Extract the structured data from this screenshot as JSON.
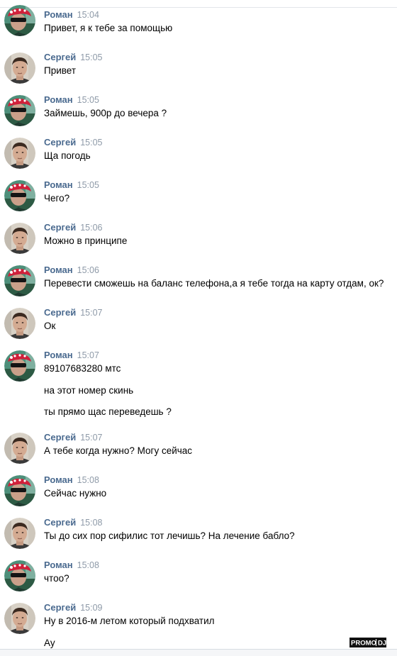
{
  "logo_text": "PROMO DJ",
  "messages": [
    {
      "author": "Роман",
      "time": "15:04",
      "lines": [
        "Привет, я к тебе за помощью"
      ]
    },
    {
      "author": "Сергей",
      "time": "15:05",
      "lines": [
        "Привет"
      ]
    },
    {
      "author": "Роман",
      "time": "15:05",
      "lines": [
        "Займешь, 900р до вечера ?"
      ]
    },
    {
      "author": "Сергей",
      "time": "15:05",
      "lines": [
        "Ща погодь"
      ]
    },
    {
      "author": "Роман",
      "time": "15:05",
      "lines": [
        "Чего?"
      ]
    },
    {
      "author": "Сергей",
      "time": "15:06",
      "lines": [
        "Можно в принципе"
      ]
    },
    {
      "author": "Роман",
      "time": "15:06",
      "lines": [
        "Перевести сможешь на баланс телефона,а я тебе тогда на карту отдам, ок?"
      ]
    },
    {
      "author": "Сергей",
      "time": "15:07",
      "lines": [
        "Ок"
      ]
    },
    {
      "author": "Роман",
      "time": "15:07",
      "lines": [
        "89107683280 мтс",
        "на этот номер скинь",
        "ты прямо щас переведешь ?"
      ]
    },
    {
      "author": "Сергей",
      "time": "15:07",
      "lines": [
        "А тебе когда нужно? Могу сейчас"
      ]
    },
    {
      "author": "Роман",
      "time": "15:08",
      "lines": [
        "Сейчас нужно"
      ]
    },
    {
      "author": "Сергей",
      "time": "15:08",
      "lines": [
        "Ты до сих пор сифилис тот лечишь? На лечение бабло?"
      ]
    },
    {
      "author": "Роман",
      "time": "15:08",
      "lines": [
        "чтоо?"
      ]
    },
    {
      "author": "Сергей",
      "time": "15:09",
      "lines": [
        "Ну в 2016-м летом который подхватил",
        "Ау"
      ]
    }
  ]
}
